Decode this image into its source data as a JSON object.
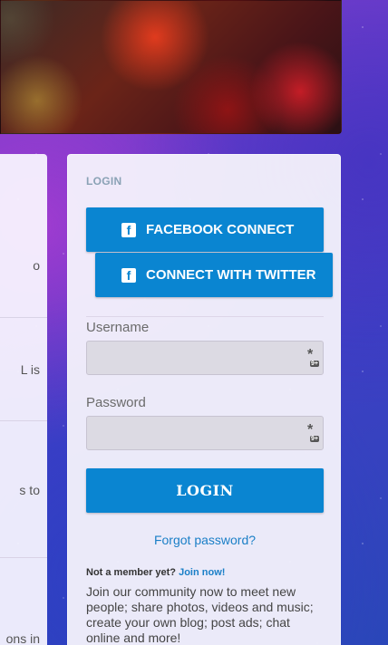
{
  "left_panel": {
    "fragments": [
      "o",
      "L is",
      "s to",
      "ons in"
    ]
  },
  "login": {
    "title": "LOGIN",
    "facebook_label": "FACEBOOK CONNECT",
    "twitter_label": "CONNECT WITH TWITTER",
    "username_label": "Username",
    "username_value": "",
    "password_label": "Password",
    "password_value": "",
    "password_manager_badge": "9+",
    "login_label": "LOGIN",
    "forgot_label": "Forgot password?",
    "not_member": "Not a member yet?",
    "join_label": "Join now!",
    "blurb": "Join our community now to meet new people; share photos, videos and music; create your own blog; post ads; chat online and more!"
  },
  "colors": {
    "button_blue": "#0a85d1",
    "link_blue": "#1a7fc7",
    "title_gray": "#8aa2b5"
  },
  "icons": [
    "facebook-icon",
    "password-manager-icon"
  ]
}
